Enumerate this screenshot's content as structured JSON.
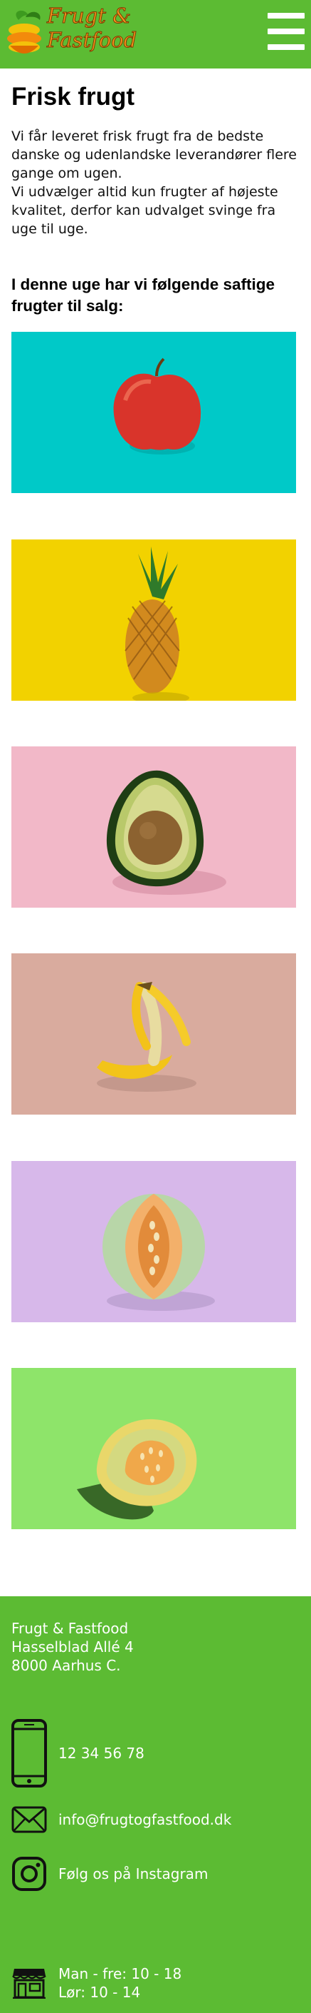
{
  "header": {
    "logo_line1": "Frugt &",
    "logo_line2": "Fastfood",
    "menu_icon": "hamburger-menu-icon"
  },
  "main": {
    "title": "Frisk frugt",
    "intro_line1": "Vi får leveret frisk frugt fra de bedste danske og udenlandske leverandører flere gange om ugen.",
    "intro_line2": "Vi udvælger altid kun frugter af højeste kvalitet, derfor kan udvalget svinge fra uge til uge.",
    "subheading": "I denne uge har vi følgende saftige frugter til salg:",
    "fruits": [
      {
        "name": "apple",
        "background": "#00c9c8"
      },
      {
        "name": "pineapple",
        "background": "#f2d200"
      },
      {
        "name": "avocado",
        "background": "#f2b8c8"
      },
      {
        "name": "banana",
        "background": "#d9ab9e"
      },
      {
        "name": "melon",
        "background": "#d7b8ea"
      },
      {
        "name": "cantaloupe",
        "background": "#8ee46a"
      }
    ]
  },
  "footer": {
    "company": "Frugt & Fastfood",
    "street": "Hasselblad Allé 4",
    "city": "8000 Aarhus C.",
    "phone": "12 34 56 78",
    "email": "info@frugtogfastfood.dk",
    "instagram": "Følg os på Instagram",
    "hours_weekdays": "Man - fre: 10 - 18",
    "hours_saturday": "Lør: 10 - 14",
    "icons": [
      "phone-icon",
      "mail-icon",
      "instagram-icon",
      "store-icon"
    ]
  },
  "colors": {
    "brand_green": "#5cbb33",
    "logo_orange": "#f7941d"
  }
}
